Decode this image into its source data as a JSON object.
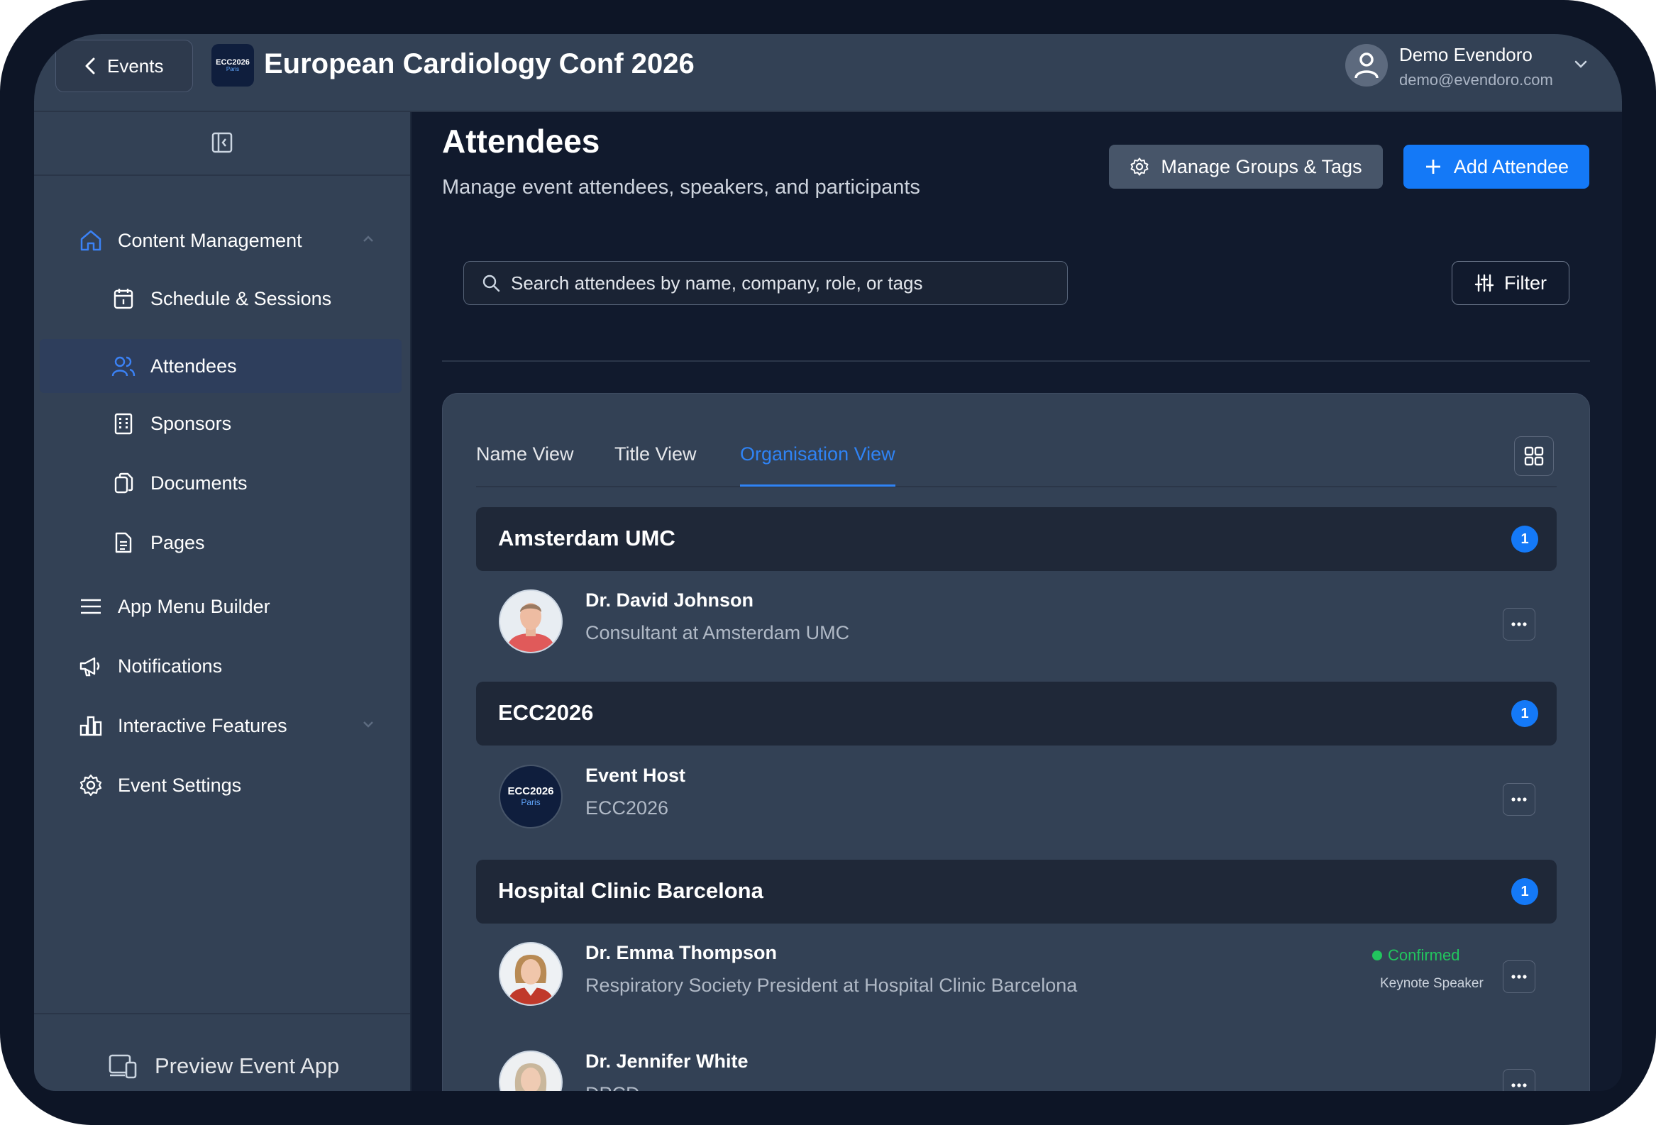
{
  "header": {
    "back_label": "Events",
    "event_logo": {
      "line1": "ECC2026",
      "line2": "Paris"
    },
    "event_title": "European Cardiology Conf 2026",
    "user_name": "Demo Evendoro",
    "user_email": "demo@evendoro.com"
  },
  "sidebar": {
    "items": [
      {
        "label": "Content Management",
        "icon": "home-icon"
      },
      {
        "label": "Schedule & Sessions",
        "icon": "calendar-icon"
      },
      {
        "label": "Attendees",
        "icon": "users-icon"
      },
      {
        "label": "Sponsors",
        "icon": "building-icon"
      },
      {
        "label": "Documents",
        "icon": "documents-icon"
      },
      {
        "label": "Pages",
        "icon": "page-icon"
      },
      {
        "label": "App Menu Builder",
        "icon": "menu-icon"
      },
      {
        "label": "Notifications",
        "icon": "megaphone-icon"
      },
      {
        "label": "Interactive Features",
        "icon": "bar-chart-icon"
      },
      {
        "label": "Event Settings",
        "icon": "gear-icon"
      }
    ],
    "preview_label": "Preview Event App"
  },
  "main": {
    "title": "Attendees",
    "subtitle": "Manage event attendees, speakers, and participants",
    "manage_groups_label": "Manage Groups & Tags",
    "add_attendee_label": "Add Attendee",
    "search_placeholder": "Search attendees by name, company, role, or tags",
    "filter_label": "Filter",
    "tabs": [
      {
        "label": "Name View"
      },
      {
        "label": "Title View"
      },
      {
        "label": "Organisation View"
      }
    ],
    "groups": [
      {
        "name": "Amsterdam UMC",
        "count": "1"
      },
      {
        "name": "ECC2026",
        "count": "1"
      },
      {
        "name": "Hospital Clinic Barcelona",
        "count": "1"
      }
    ],
    "people": [
      {
        "name": "Dr. David Johnson",
        "title": "Consultant at Amsterdam UMC"
      },
      {
        "name": "Event Host",
        "title": "ECC2026"
      },
      {
        "name": "Dr. Emma Thompson",
        "title": "Respiratory Society President at Hospital Clinic Barcelona",
        "status": "Confirmed",
        "role": "Keynote Speaker"
      },
      {
        "name": "Dr. Jennifer White",
        "title": "DPCD"
      }
    ]
  },
  "colors": {
    "accent": "#1479f7",
    "confirmed": "#22c55e",
    "sidebar_bg": "#334155",
    "page_bg": "#111a2d"
  }
}
